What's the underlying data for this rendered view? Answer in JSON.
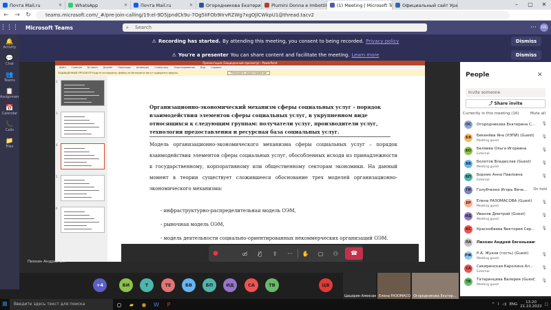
{
  "browser": {
    "tabs": [
      {
        "title": "Почта Mail.ru",
        "favcolor": "#005ff9"
      },
      {
        "title": "WhatsApp",
        "favcolor": "#25d366"
      },
      {
        "title": "Почта Mail.ru",
        "favcolor": "#005ff9"
      },
      {
        "title": "Огородникова Екатерина Сергеевна",
        "favcolor": "#2a5699"
      },
      {
        "title": "Plumini Donna e Imbottiti, Cap...",
        "favcolor": "#c0392b"
      },
      {
        "title": "(1) Meeting | Microsoft Teams",
        "favcolor": "#5558af"
      },
      {
        "title": "Официальный сайт Уральского...",
        "favcolor": "#2b6cb0"
      }
    ],
    "url": "teams.microsoft.com/_#/pre-join-calling/19:el-9D5jpndCk9u-7Og5IIFOb9IIrvRZWg7xgOJlCWkpU1@thread.tacv2"
  },
  "teams": {
    "app_name": "Microsoft Teams",
    "search_placeholder": "Search",
    "avatar_initials": "OS",
    "banners": [
      {
        "title": "Recording has started.",
        "text": "By attending this meeting, you consent to being recorded.",
        "link": "Privacy policy",
        "dismiss": "Dismiss"
      },
      {
        "title": "You're a presenter",
        "text": "You can share content and facilitate the meeting.",
        "link": "Learn more",
        "dismiss": "Dismiss"
      }
    ],
    "rail": [
      "Activity",
      "Chat",
      "Teams",
      "Assignments",
      "Calendar",
      "Calls",
      "Files"
    ]
  },
  "ppt": {
    "window_title": "Презентация (Защищенный просмотр) - PowerPoint",
    "ribbon": [
      "Файл",
      "Главная",
      "Вставка",
      "Дизайн",
      "Переходы",
      "Анимация",
      "Слайд-шоу",
      "Рецензирование",
      "Вид",
      "Справка"
    ],
    "notice": "ЗАЩИЩЕННЫЙ ПРОСМОТР Будьте осторожны: файлы из Интернета могут содержать вирусы.",
    "notice_button": "Разрешить редактирование",
    "slide_heading": "Организационно-экономический механизм сферы социальных услуг - порядок взаимодействия элементов сферы социальных услуг, в укрупненном виде относящихся к следующим группам: получатели услуг, производители услуг, технологии предоставления и ресурсная база социальных услуг.",
    "slide_paragraph": "Модель организационно-экономического механизма сферы социальных услуг – порядок взаимодействия элементов сферы социальных услуг, обособленных исходя из принадлежности к государственному, корпоративному или общественному секторам экономики. На данный момент в теории существует сложившееся обоснование трех моделей организационно-экономического механизма:",
    "bullets": [
      "- инфраструктурно-распределительная модель ОЭМ,",
      "- рыночная модель ОЭМ,",
      "- модель деятельности социально-ориентированных некоммерческих организаций ОЭМ."
    ],
    "thumb_numbers": [
      "2",
      "3",
      "4",
      "5",
      "6"
    ]
  },
  "presenter_name": "Пихкин Андрей Е...",
  "participant_bar": {
    "more_count": "+4",
    "avatars": [
      {
        "initials": "БИ",
        "color": "#8bc34a"
      },
      {
        "initials": "Т",
        "color": "#4db6ac"
      },
      {
        "initials": "ТЕ",
        "color": "#e57373"
      },
      {
        "initials": "БВ",
        "color": "#64b5f6"
      },
      {
        "initials": "БП",
        "color": "#4db6ac"
      },
      {
        "initials": "ИД",
        "color": "#9575cd"
      },
      {
        "initials": "СА",
        "color": "#ef5350"
      },
      {
        "initials": "ТВ",
        "color": "#66bb6a"
      },
      {
        "initials": "ЦВ",
        "color": "#e53935"
      }
    ],
    "video_tiles": [
      "Цацорин Александр...",
      "Елена РАЗОМАСОВА ...",
      "Огородникова Екатер..."
    ]
  },
  "people": {
    "title": "People",
    "invite_placeholder": "Invite someone",
    "share_invite": "Share invite",
    "in_meeting": "Currently in this meeting (16)",
    "mute_all": "Mute all",
    "list": [
      {
        "initials": "ОС",
        "color": "#8fa9d6",
        "name": "Огородникова Екатерина С...",
        "sub": "",
        "status": "mic"
      },
      {
        "initials": "БЯ",
        "color": "#f4b860",
        "name": "Бекенёва Яна (УЭПИ) (Guest)",
        "sub": "Meeting guest",
        "status": "mic"
      },
      {
        "initials": "БО",
        "color": "#8bc34a",
        "name": "Беляева Ольга Игоревна",
        "sub": "External",
        "status": "mic"
      },
      {
        "initials": "БВ",
        "color": "#64b5f6",
        "name": "Болотов Владислав (Guest)",
        "sub": "Meeting guest",
        "status": "mic"
      },
      {
        "initials": "БП",
        "color": "#4db6ac",
        "name": "Борних Анна Павловна",
        "sub": "External",
        "status": "mic"
      },
      {
        "initials": "ГИ",
        "color": "#7986cb",
        "name": "Голубченко Игорь Вяче...",
        "sub": "",
        "status": "On hold"
      },
      {
        "initials": "ЕР",
        "color": "#ffab91",
        "name": "Елена РАЗОМАСОВА (Guest)",
        "sub": "Meeting guest",
        "status": "mic"
      },
      {
        "initials": "ИД",
        "color": "#9575cd",
        "name": "Иванов Дмитрий (Guest)",
        "sub": "Meeting guest",
        "status": "mic"
      },
      {
        "initials": "КС",
        "color": "#ef5350",
        "name": "Краснобаева Виктория Сер...",
        "sub": "",
        "status": "mic"
      },
      {
        "initials": "ПА",
        "color": "#c0c0c0",
        "name": "Пихкин Андрей Евгеньевич",
        "sub": "",
        "status": "none"
      },
      {
        "initials": "РЖ",
        "color": "#90caf9",
        "name": "Р.А. Жуков (гость) (Guest)",
        "sub": "Meeting guest",
        "status": "mic"
      },
      {
        "initials": "СА",
        "color": "#ef5350",
        "name": "Сикиринская Каролина Ал...",
        "sub": "External",
        "status": "mic"
      },
      {
        "initials": "ТВ",
        "color": "#66bb6a",
        "name": "Татаринцева Валерия (Guest)",
        "sub": "Meeting guest",
        "status": "mic"
      }
    ]
  },
  "taskbar": {
    "search_placeholder": "Введите здесь текст для поиска",
    "lang": "ENG",
    "time": "13:20",
    "date": "21.10.2022"
  }
}
